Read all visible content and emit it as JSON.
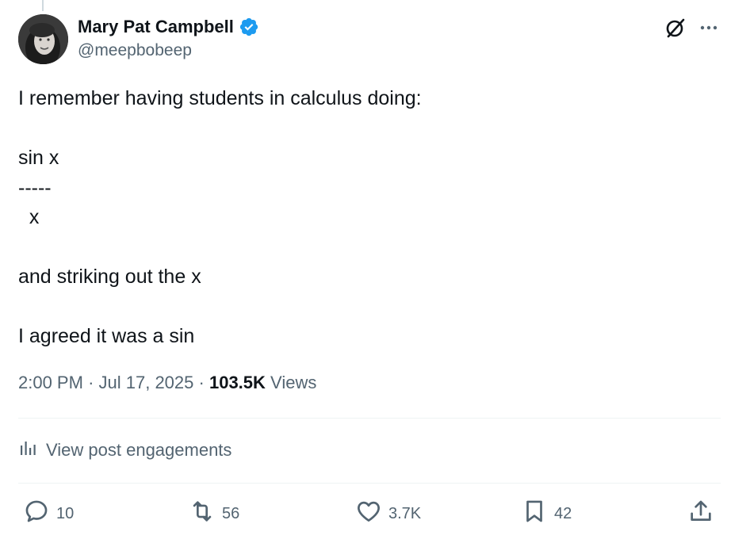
{
  "author": {
    "display_name": "Mary Pat Campbell",
    "handle": "@meepbobeep",
    "verified": true
  },
  "post": {
    "lines": [
      "I remember having students in calculus doing:",
      "",
      "sin x",
      "-----",
      "  x",
      "",
      "and striking out the x",
      "",
      "I agreed it was a sin"
    ]
  },
  "meta": {
    "time": "2:00 PM",
    "separator": "·",
    "date": "Jul 17, 2025",
    "views_count": "103.5K",
    "views_label": "Views"
  },
  "engagements_label": "View post engagements",
  "actions": {
    "replies": "10",
    "reposts": "56",
    "likes": "3.7K",
    "bookmarks": "42"
  },
  "icons": {
    "verified": "verified-badge-icon",
    "grok": "grok-icon",
    "more": "more-icon",
    "engagements": "bar-chart-icon",
    "reply": "reply-icon",
    "repost": "repost-icon",
    "like": "heart-icon",
    "bookmark": "bookmark-icon",
    "share": "share-icon"
  },
  "colors": {
    "accent_blue": "#1d9bf0",
    "text_primary": "#0f1419",
    "text_secondary": "#536471",
    "divider": "#eff3f4"
  }
}
